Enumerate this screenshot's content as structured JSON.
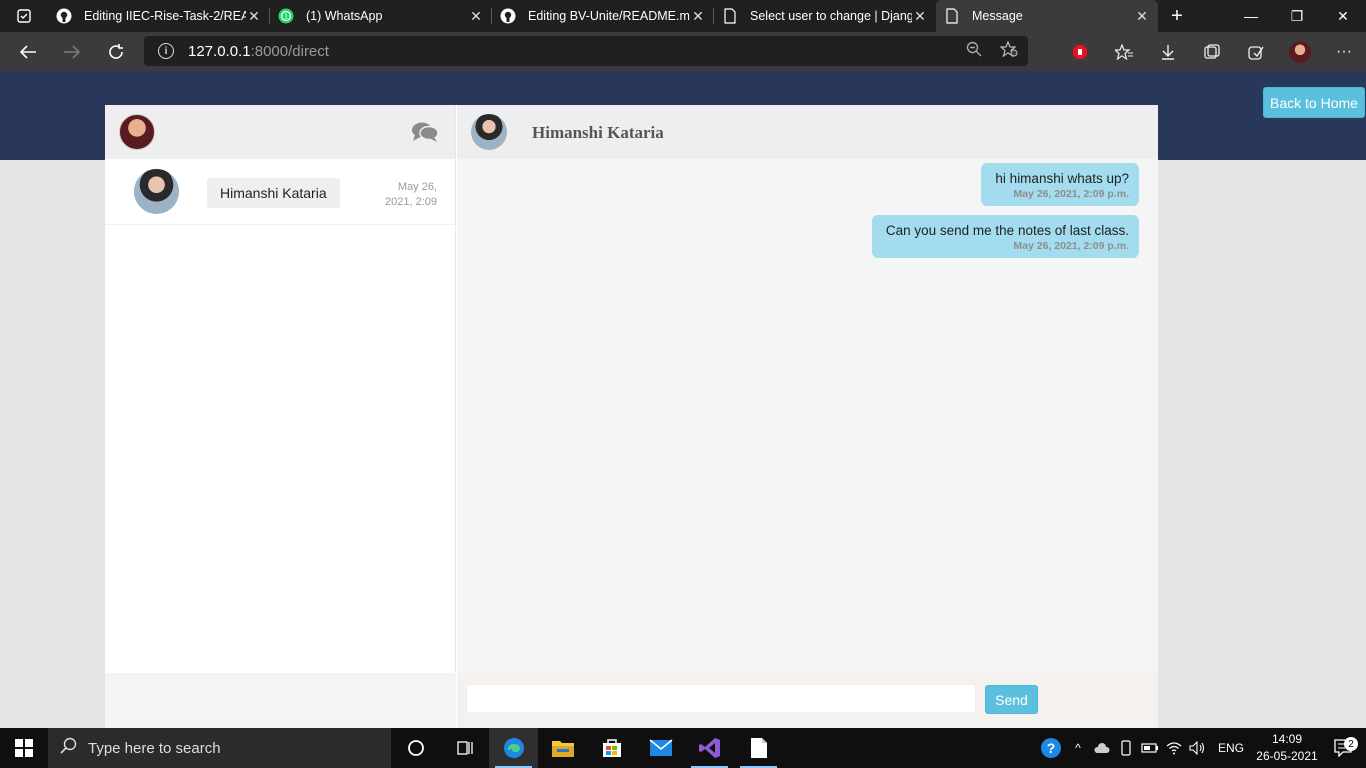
{
  "browser": {
    "tabs": [
      {
        "title": "Editing IIEC-Rise-Task-2/READ",
        "icon": "github-icon",
        "active": false
      },
      {
        "title": "(1) WhatsApp",
        "icon": "whatsapp-icon",
        "active": false
      },
      {
        "title": "Editing BV-Unite/README.md",
        "icon": "github-icon",
        "active": false
      },
      {
        "title": "Select user to change | Djang",
        "icon": "page-icon",
        "active": false
      },
      {
        "title": "Message",
        "icon": "page-icon",
        "active": true
      }
    ],
    "url": {
      "host": "127.0.0.1",
      "path": ":8000/direct"
    }
  },
  "page": {
    "back_home_label": "Back to Home",
    "threads": [
      {
        "name": "Himanshi Kataria",
        "time": "May 26, 2021, 2:09"
      }
    ],
    "active_chat": {
      "name": "Himanshi Kataria",
      "messages": [
        {
          "text": "hi himanshi whats up?",
          "time": "May 26, 2021, 2:09 p.m."
        },
        {
          "text": "Can you send me the notes of last class.",
          "time": "May 26, 2021, 2:09 p.m."
        }
      ]
    },
    "compose": {
      "placeholder": "",
      "send_label": "Send"
    }
  },
  "taskbar": {
    "search_placeholder": "Type here to search",
    "language": "ENG",
    "time": "14:09",
    "date": "26-05-2021",
    "notification_count": "2"
  },
  "colors": {
    "header": "#29375a",
    "accent": "#5bc0de",
    "bubble": "#a2dcee"
  }
}
